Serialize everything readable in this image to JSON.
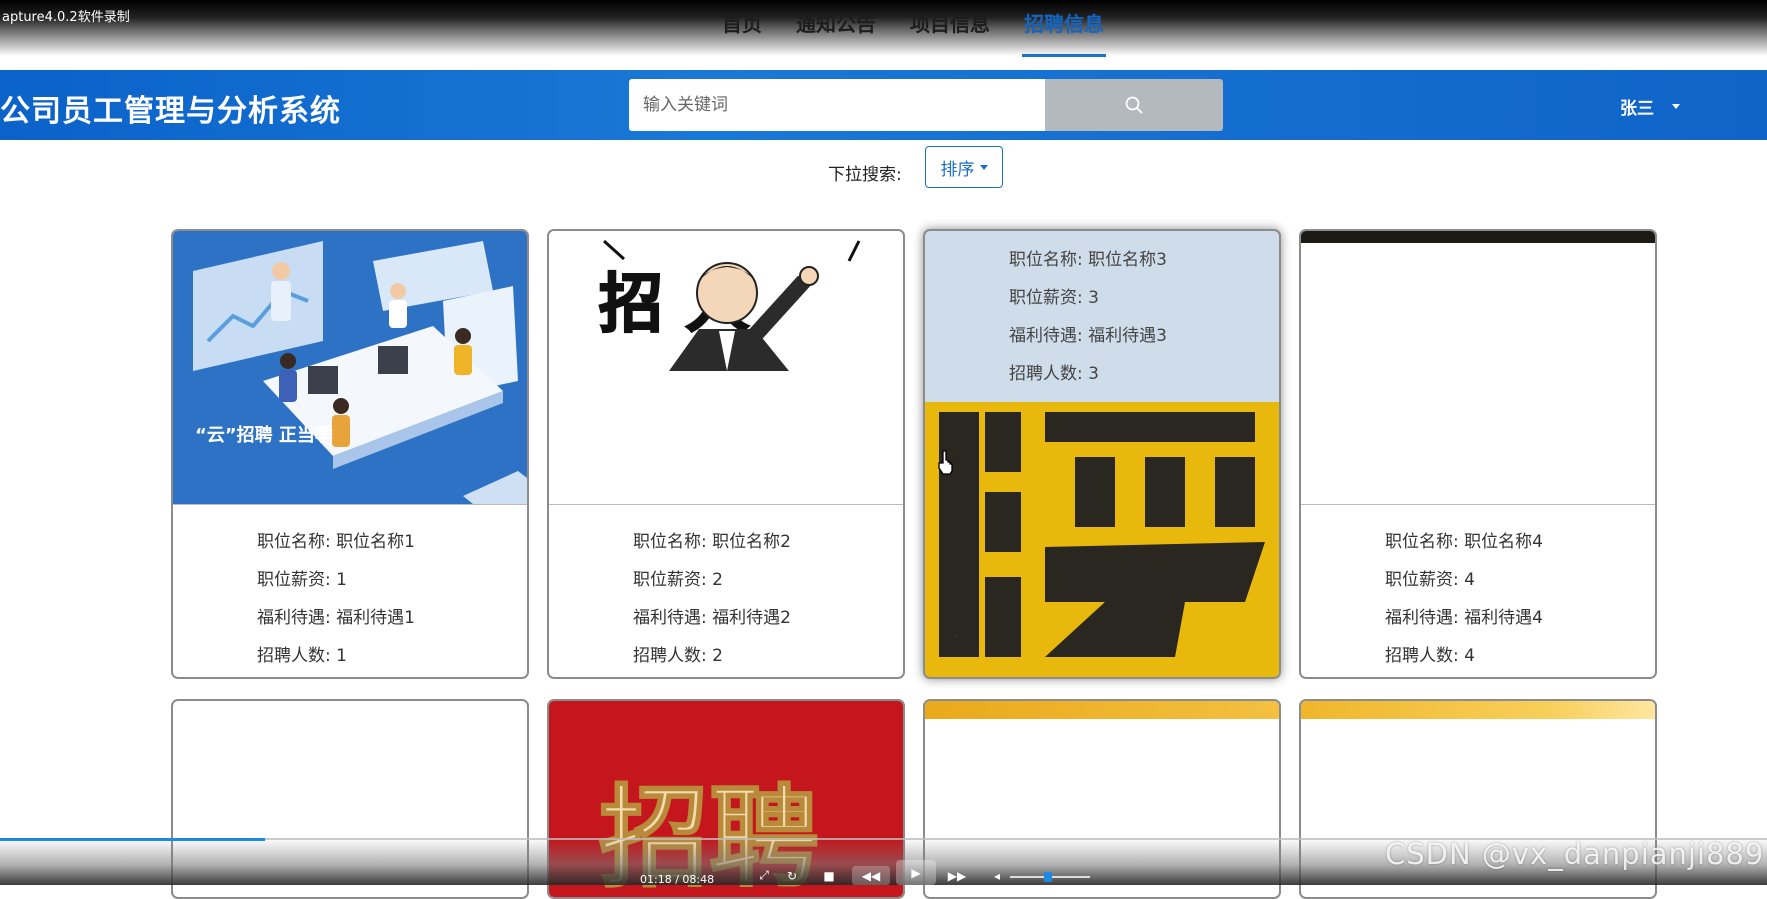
{
  "recorder": {
    "label": "apture4.0.2软件录制"
  },
  "nav": [
    {
      "label": "首页"
    },
    {
      "label": "通知公告"
    },
    {
      "label": "项目信息"
    },
    {
      "label": "招聘信息"
    }
  ],
  "header": {
    "site_title": "公司员工管理与分析系统",
    "search_placeholder": "输入关键词",
    "user_name": "张三"
  },
  "filter": {
    "label": "下拉搜索:",
    "sort_label": "排序"
  },
  "cards": [
    {
      "name": "职位名称: 职位名称1",
      "salary": "职位薪资: 1",
      "welfare": "福利待遇: 福利待遇1",
      "count": "招聘人数: 1",
      "image_text": "“云”招聘 正当季"
    },
    {
      "name": "职位名称: 职位名称2",
      "salary": "职位薪资: 2",
      "welfare": "福利待遇: 福利待遇2",
      "count": "招聘人数: 2",
      "image_text": "招 人"
    },
    {
      "name": "职位名称: 职位名称3",
      "salary": "职位薪资: 3",
      "welfare": "福利待遇: 福利待遇3",
      "count": "招聘人数: 3",
      "image_text": "聘"
    },
    {
      "name": "职位名称: 职位名称4",
      "salary": "职位薪资: 4",
      "welfare": "福利待遇: 福利待遇4",
      "count": "招聘人数: 4"
    }
  ],
  "second_row": [
    {
      "image_text": ""
    },
    {
      "image_text": "招聘"
    },
    {
      "image_text": ""
    },
    {
      "image_text": ""
    }
  ],
  "player": {
    "time": "01:18 / 08:48",
    "progress": 0.15
  },
  "watermark": "CSDN @vx_danpianji889",
  "colors": {
    "header_blue": "#0b62c9",
    "active_nav": "#1565c0",
    "accent": "#1a6fc4"
  }
}
